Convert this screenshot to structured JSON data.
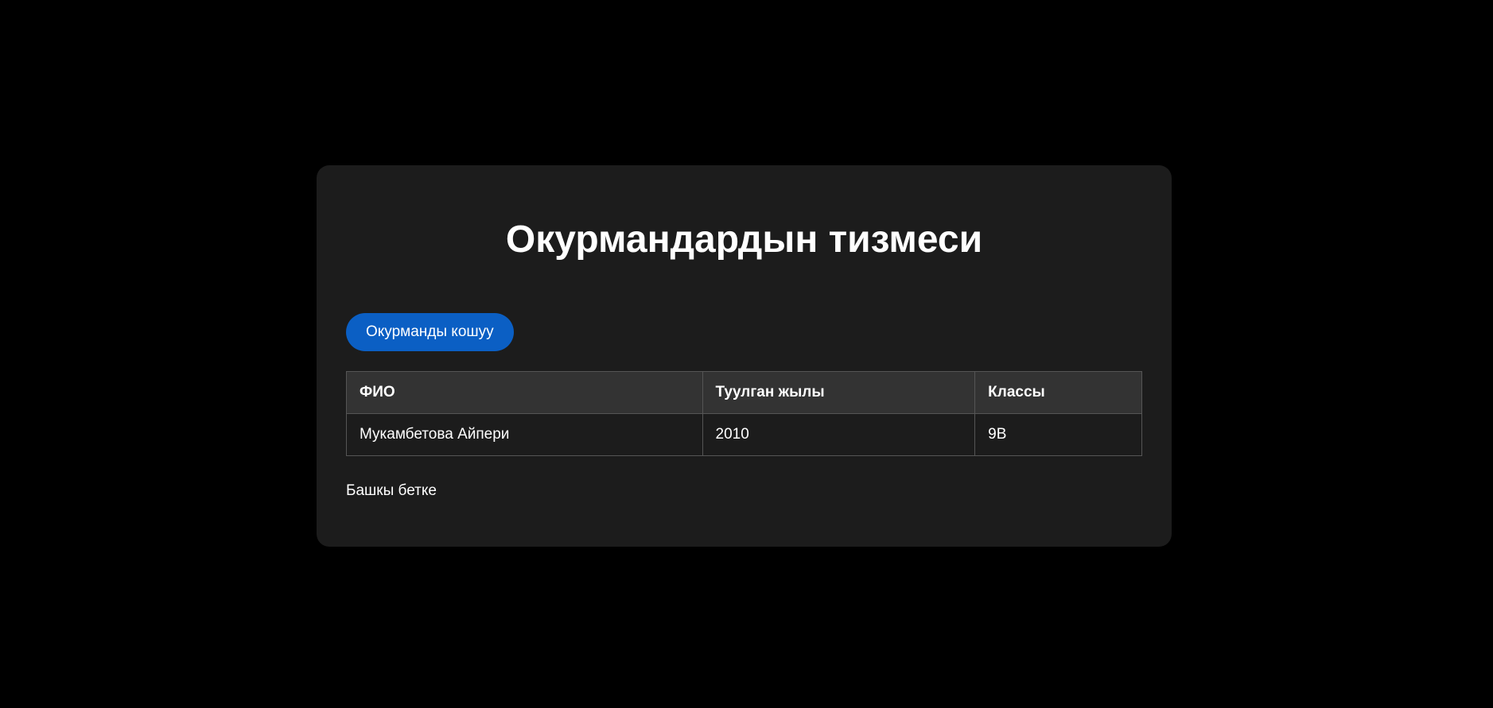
{
  "page": {
    "title": "Окурмандардын тизмеси",
    "add_button_label": "Окурманды кошуу",
    "home_link_label": "Башкы бетке"
  },
  "table": {
    "headers": [
      "ФИО",
      "Туулган жылы",
      "Классы"
    ],
    "rows": [
      [
        "Мукамбетова Айпери",
        "2010",
        "9В"
      ]
    ]
  },
  "colors": {
    "background": "#000000",
    "card": "#1c1c1c",
    "header_row": "#333333",
    "accent": "#0b5fc4",
    "border": "#555555",
    "text": "#ffffff"
  }
}
